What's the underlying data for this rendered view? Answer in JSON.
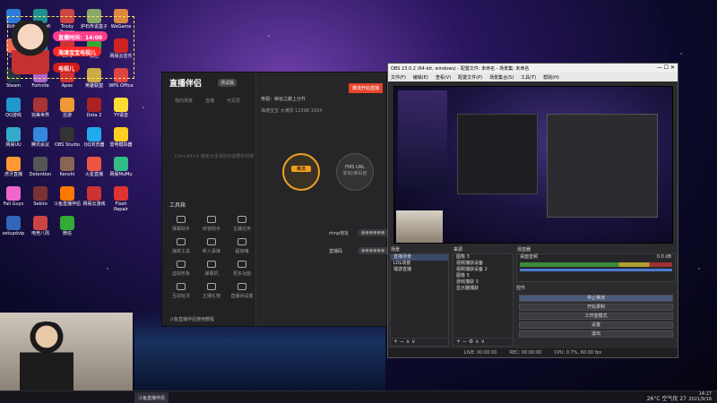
{
  "desktop_icons": [
    {
      "label": "Bilibili",
      "color": "#2d7bd6"
    },
    {
      "label": "Microsoft Edge",
      "color": "#1f8f8f"
    },
    {
      "label": "Tricky Towers",
      "color": "#c44"
    },
    {
      "label": "炉石传说盒子",
      "color": "#8a6"
    },
    {
      "label": "WeGame",
      "color": "#d84"
    },
    {
      "label": "斗鱼",
      "color": "#e65"
    },
    {
      "label": "QQ",
      "color": "#38c"
    },
    {
      "label": "WPS",
      "color": "#c33"
    },
    {
      "label": "微信",
      "color": "#3a3"
    },
    {
      "label": "网易云音乐",
      "color": "#c22"
    },
    {
      "label": "Steam",
      "color": "#234"
    },
    {
      "label": "Fortnite",
      "color": "#a6c"
    },
    {
      "label": "Apex",
      "color": "#c33"
    },
    {
      "label": "英雄联盟",
      "color": "#ca4"
    },
    {
      "label": "WPS Office",
      "color": "#d44"
    },
    {
      "label": "QQ游戏",
      "color": "#29c"
    },
    {
      "label": "完美世界",
      "color": "#a33"
    },
    {
      "label": "迅游",
      "color": "#e93"
    },
    {
      "label": "Dota 2",
      "color": "#a22"
    },
    {
      "label": "YY语音",
      "color": "#fd3"
    },
    {
      "label": "网易UU",
      "color": "#3ac"
    },
    {
      "label": "腾讯会议",
      "color": "#38d"
    },
    {
      "label": "OBS Studio",
      "color": "#333"
    },
    {
      "label": "QQ浏览器",
      "color": "#2ae"
    },
    {
      "label": "雷电模拟器",
      "color": "#fc2"
    },
    {
      "label": "虎牙直播",
      "color": "#f93"
    },
    {
      "label": "Detention",
      "color": "#555"
    },
    {
      "label": "Kenshi",
      "color": "#865"
    },
    {
      "label": "火星直播",
      "color": "#e54"
    },
    {
      "label": "网易MuMu",
      "color": "#3b8"
    },
    {
      "label": "Fall Guys",
      "color": "#e6c"
    },
    {
      "label": "Sekiro",
      "color": "#733"
    },
    {
      "label": "斗鱼直播伴侣",
      "color": "#f70"
    },
    {
      "label": "网易云游戏",
      "color": "#c33"
    },
    {
      "label": "Flash Repair",
      "color": "#d33"
    },
    {
      "label": "setupdvip",
      "color": "#36b"
    },
    {
      "label": "电竞八周",
      "color": "#c44"
    },
    {
      "label": "微信",
      "color": "#3a3"
    }
  ],
  "overlay": {
    "timer": "直播时间：14:00",
    "title": "海滩宝宝电视儿",
    "subtitle": "电视儿"
  },
  "app": {
    "logo": "直播伴侣",
    "version": "测试版",
    "tabs": [
      "我的场景",
      "直播",
      "可见层"
    ],
    "empty_hint": "Ctrl+Alt+S 或者点击添加你需要的场景",
    "tools_title": "工具箱",
    "tools": [
      "弹幕助手",
      "房管助手",
      "主播任务",
      "抽奖工具",
      "新人承接",
      "超级嗨",
      "虚拟形象",
      "弹幕机",
      "更多功能",
      "互动玩法",
      "主播礼物",
      "直播间设置"
    ],
    "footer": "斗鱼直播伴侣使用教程",
    "head_line1": "电视：峡谷之巅上分升",
    "head_line2": "海滩宝宝    大满贯    12398    1934",
    "live_button": "推流开始直播",
    "rtmp_label": "rtmp地址",
    "key_label": "直播码",
    "circle1_label": "推流",
    "circle2_label": "FMS URL",
    "circle2_sub": "复制/推码链"
  },
  "obs": {
    "title": "OBS 23.0.2 (64-bit, windows) - 配置文件: 未命名 - 场景集: 未命名",
    "menu": [
      "文件(F)",
      "编辑(E)",
      "查看(V)",
      "配置文件(P)",
      "场景集合(S)",
      "工具(T)",
      "帮助(H)"
    ],
    "scenes_header": "场景",
    "scenes": [
      "直播场景",
      "LOL场景",
      "端游直播"
    ],
    "sources_header": "来源",
    "sources": [
      "图像 3",
      "视频捕获设备",
      "视频捕获设备 2",
      "图像 5",
      "游戏捕获 3",
      "显示器捕获"
    ],
    "mixer_header": "混音器",
    "mixer_label": "桌面音频",
    "mixer_value": "0.0 dB",
    "controls_header": "控件",
    "controls": [
      "停止推流",
      "开始录制",
      "工作室模式",
      "设置",
      "退出"
    ],
    "status": [
      "LIVE: 00:00:00",
      "REC: 00:00:00",
      "CPU: 0.7%, 60.00 fps"
    ]
  },
  "taskbar": {
    "app": "斗鱼直播伴侣",
    "weather": "26°C 空气优 27",
    "time": "14:17",
    "date": "2021/9/16"
  }
}
